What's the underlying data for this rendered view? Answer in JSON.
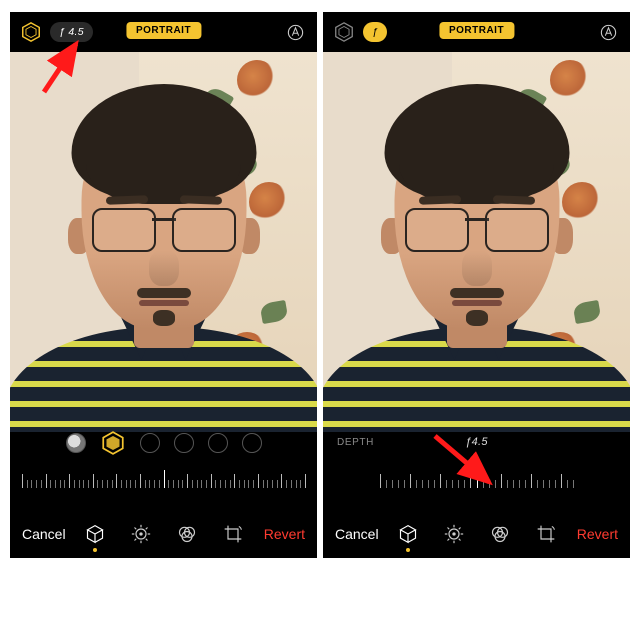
{
  "left": {
    "top": {
      "mode_label": "PORTRAIT",
      "f_value": "ƒ 4.5",
      "f_active": false
    },
    "bottom": {
      "cancel": "Cancel",
      "revert": "Revert"
    },
    "tools": {
      "active_index": 0
    }
  },
  "right": {
    "top": {
      "mode_label": "PORTRAIT",
      "f_value": "ƒ",
      "f_active": true
    },
    "depth": {
      "label": "DEPTH",
      "value": "ƒ4.5"
    },
    "bottom": {
      "cancel": "Cancel",
      "revert": "Revert"
    },
    "tools": {
      "active_index": 0
    }
  },
  "icons": {
    "lighting": "lighting-hexagon-icon",
    "aperture": "aperture-pill",
    "markup": "markup-icon",
    "cube": "portrait-cube-icon",
    "adjust": "adjust-dial-icon",
    "filters": "filters-icon",
    "crop": "crop-rotate-icon"
  },
  "colors": {
    "accent": "#f4c430",
    "destructive": "#ff3b30"
  }
}
